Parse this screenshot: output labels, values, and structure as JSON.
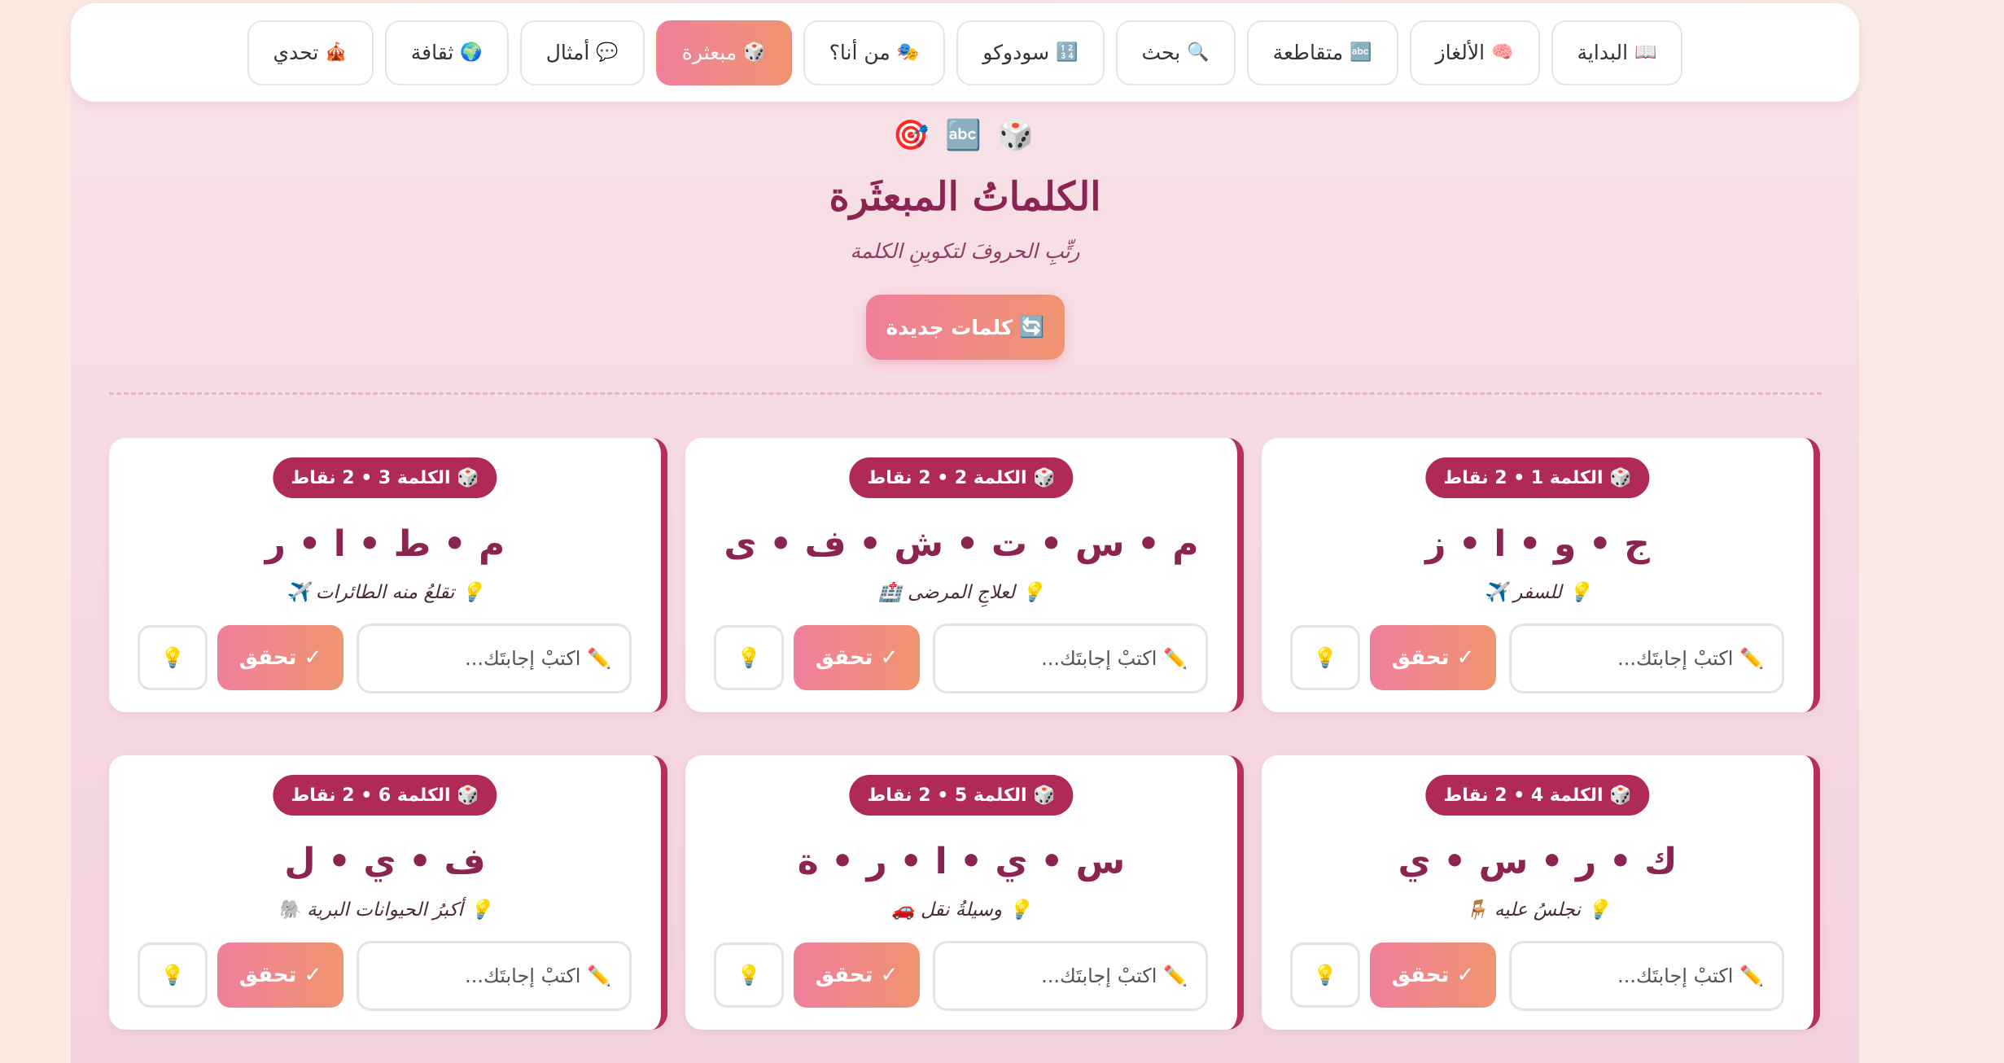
{
  "nav": {
    "items": [
      {
        "icon": "📖",
        "label": "البداية"
      },
      {
        "icon": "🧠",
        "label": "الألغاز"
      },
      {
        "icon": "🔤",
        "label": "متقاطعة"
      },
      {
        "icon": "🔍",
        "label": "بحث"
      },
      {
        "icon": "🔢",
        "label": "سودوكو"
      },
      {
        "icon": "🎭",
        "label": "من أنا؟"
      },
      {
        "icon": "🎲",
        "label": "مبعثرة",
        "active": true
      },
      {
        "icon": "💬",
        "label": "أمثال"
      },
      {
        "icon": "🌍",
        "label": "ثقافة"
      },
      {
        "icon": "🎪",
        "label": "تحدي"
      }
    ]
  },
  "header": {
    "emojis": "🎲 🔤 🎯",
    "title": "الكلماتُ المبعثَرة",
    "subtitle": "رتِّبِ الحروفَ لتكوينِ الكلمة",
    "new_words_icon": "🔄",
    "new_words_label": "كلمات جديدة"
  },
  "card_ui": {
    "badge_icon": "🎲",
    "hint_icon": "💡",
    "placeholder": "✏️ اكتبْ إجابتَك...",
    "check_label": "✓ تحقق",
    "hint_button_icon": "💡"
  },
  "cards": [
    {
      "badge": "الكلمة 1 • 2 نقاط",
      "letters": "ج • و • ا • ز",
      "hint": "للسفر ✈️"
    },
    {
      "badge": "الكلمة 2 • 2 نقاط",
      "letters": "م • س • ت • ش • ف • ى",
      "hint": "لعلاجِ المرضى 🏥"
    },
    {
      "badge": "الكلمة 3 • 2 نقاط",
      "letters": "م • ط • ا • ر",
      "hint": "تقلعُ منه الطائرات ✈️"
    },
    {
      "badge": "الكلمة 4 • 2 نقاط",
      "letters": "ك • ر • س • ي",
      "hint": "نجلسُ عليه 🪑"
    },
    {
      "badge": "الكلمة 5 • 2 نقاط",
      "letters": "س • ي • ا • ر • ة",
      "hint": "وسيلةُ نقل 🚗"
    },
    {
      "badge": "الكلمة 6 • 2 نقاط",
      "letters": "ف • ي • ل",
      "hint": "أكبرُ الحيوانات البرية 🐘"
    }
  ]
}
